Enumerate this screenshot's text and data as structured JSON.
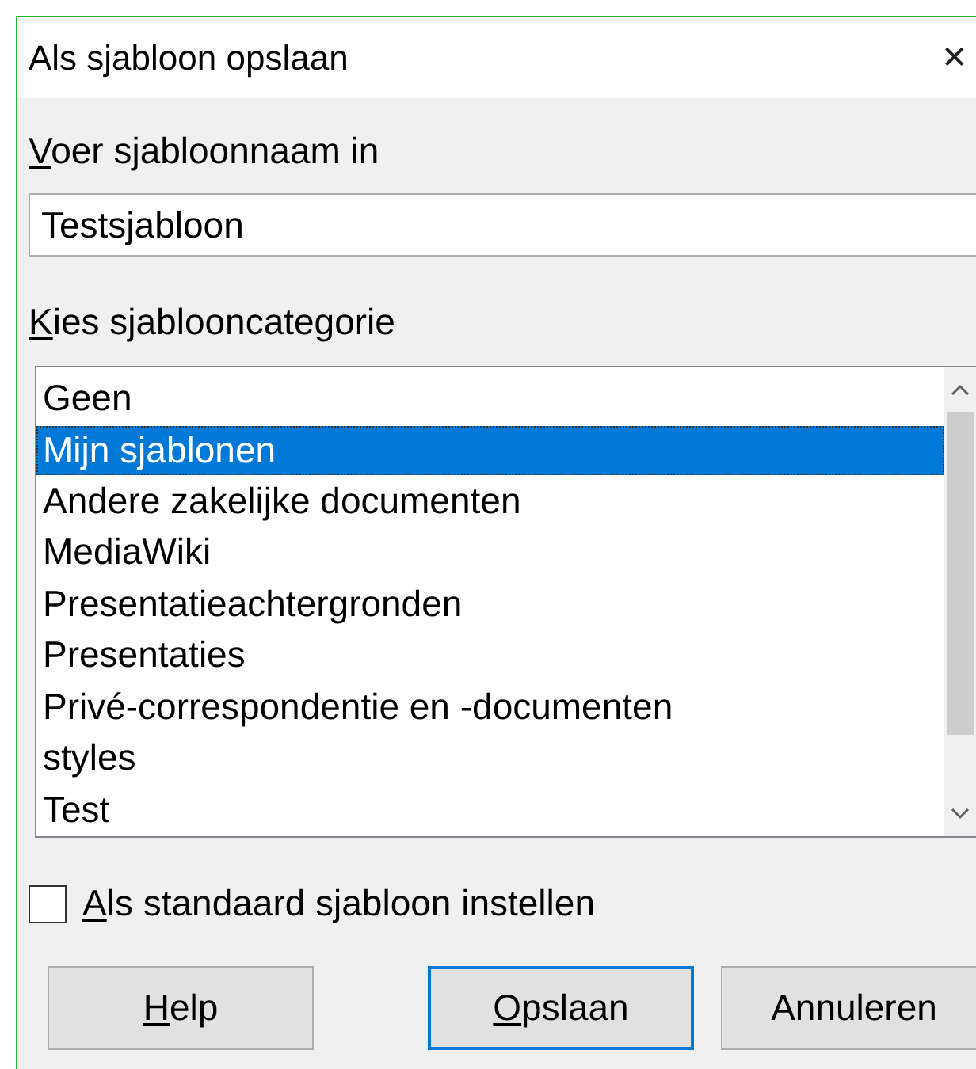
{
  "window": {
    "title": "Als sjabloon opslaan",
    "close_glyph": "✕"
  },
  "name_label": {
    "text": "Voer sjabloonnaam in",
    "mnemonic": true
  },
  "name_field": {
    "value": "Testsjabloon"
  },
  "category_label": {
    "text": "Kies sjablooncategorie",
    "mnemonic": true
  },
  "categories": [
    {
      "label": "Geen",
      "selected": false
    },
    {
      "label": "Mijn sjablonen",
      "selected": true
    },
    {
      "label": "Andere zakelijke documenten",
      "selected": false
    },
    {
      "label": "MediaWiki",
      "selected": false
    },
    {
      "label": "Presentatieachtergronden",
      "selected": false
    },
    {
      "label": "Presentaties",
      "selected": false
    },
    {
      "label": "Privé-correspondentie en -documenten",
      "selected": false
    },
    {
      "label": "styles",
      "selected": false
    },
    {
      "label": "Test",
      "selected": false
    }
  ],
  "default_checkbox": {
    "label": "Als standaard sjabloon instellen",
    "mnemonic": true,
    "checked": false
  },
  "buttons": [
    {
      "label": "Help",
      "mnemonic": true,
      "default": false
    },
    {
      "label": "Opslaan",
      "mnemonic": true,
      "default": true
    },
    {
      "label": "Annuleren",
      "mnemonic": false,
      "default": false
    }
  ]
}
